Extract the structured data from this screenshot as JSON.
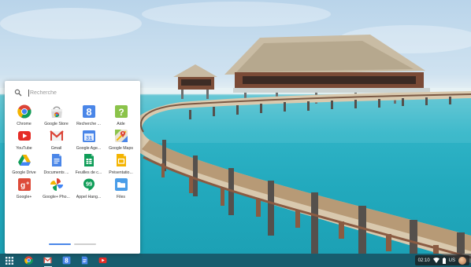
{
  "launcher": {
    "search_placeholder": "Recherche",
    "apps": [
      {
        "label": "Chrome",
        "icon": "chrome-icon"
      },
      {
        "label": "Google Store",
        "icon": "store-icon"
      },
      {
        "label": "Recherche ...",
        "icon": "search-app-icon"
      },
      {
        "label": "Aide",
        "icon": "help-icon"
      },
      {
        "label": "YouTube",
        "icon": "youtube-icon"
      },
      {
        "label": "Gmail",
        "icon": "gmail-icon"
      },
      {
        "label": "Google Age...",
        "icon": "calendar-icon"
      },
      {
        "label": "Google Maps",
        "icon": "maps-icon"
      },
      {
        "label": "Google Drive",
        "icon": "drive-icon"
      },
      {
        "label": "Documents ...",
        "icon": "docs-icon"
      },
      {
        "label": "Feuilles de c...",
        "icon": "sheets-icon"
      },
      {
        "label": "Présentatio...",
        "icon": "slides-icon"
      },
      {
        "label": "Google+",
        "icon": "google-plus-icon"
      },
      {
        "label": "Google+ Pho...",
        "icon": "photos-icon"
      },
      {
        "label": "Appel Hang...",
        "icon": "hangouts-icon"
      },
      {
        "label": "Files",
        "icon": "files-icon"
      }
    ],
    "pages": 2,
    "active_page": 1
  },
  "shelf": {
    "items": [
      "launcher-icon",
      "chrome-icon",
      "gmail-icon",
      "search-app-icon",
      "docs-icon",
      "youtube-icon"
    ],
    "status": {
      "time": "02:10",
      "keyboard": "US"
    }
  },
  "colors": {
    "blue": "#4285f4",
    "red": "#db4437",
    "yellow": "#f4b400",
    "green": "#0f9d58",
    "shelf": "#142634",
    "accent": "#4a86e8"
  }
}
